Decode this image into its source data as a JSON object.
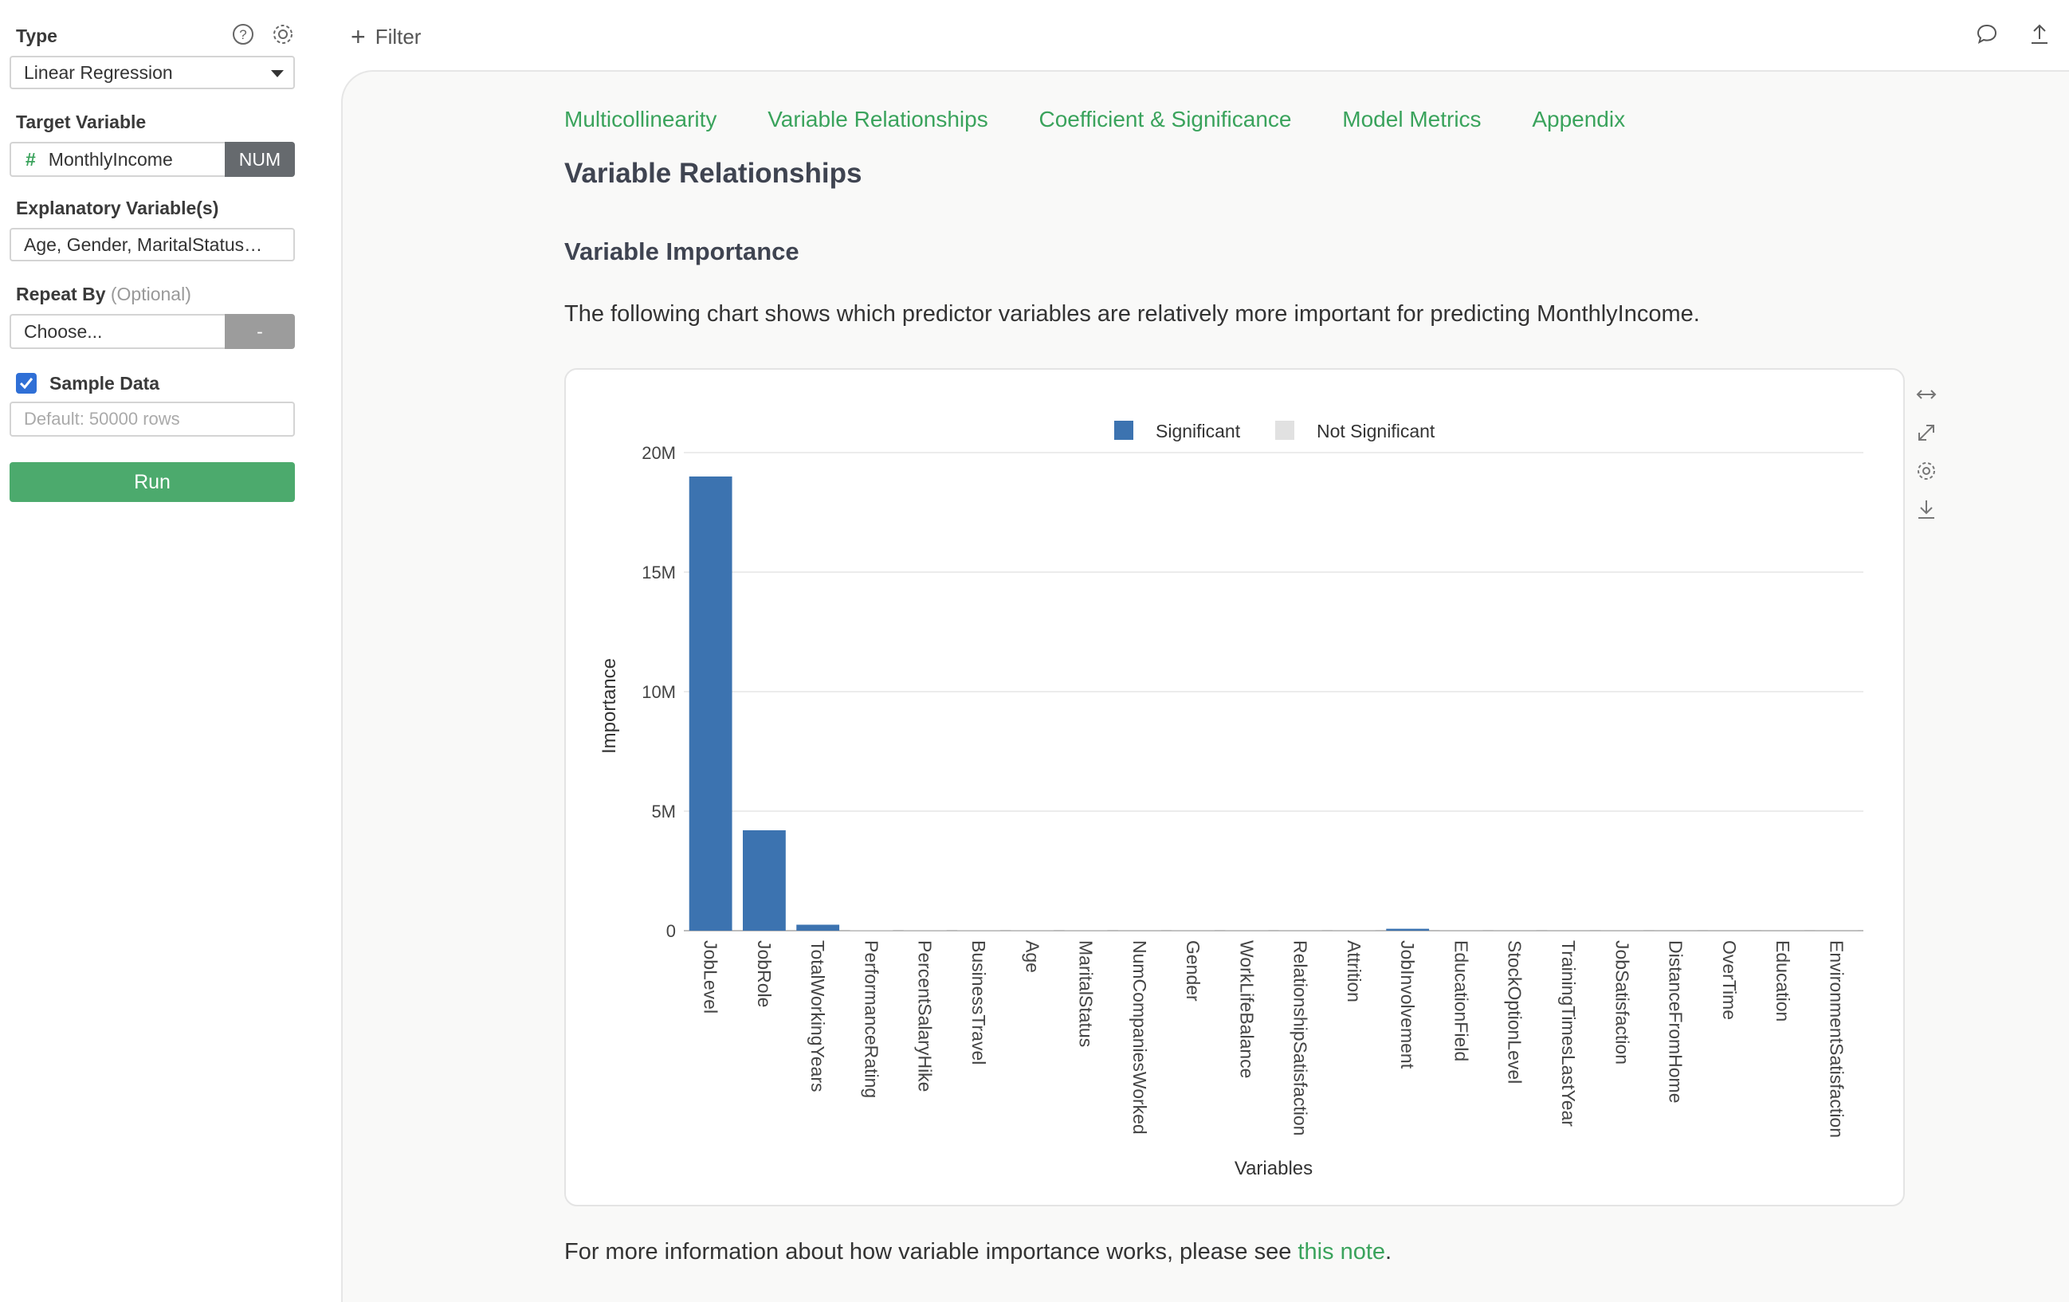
{
  "sidebar": {
    "type_label": "Type",
    "type_value": "Linear Regression",
    "target_label": "Target Variable",
    "target_hash": "#",
    "target_value": "MonthlyIncome",
    "target_badge": "NUM",
    "explanatory_label": "Explanatory Variable(s)",
    "explanatory_value": "Age, Gender, MaritalStatus…",
    "repeat_label": "Repeat By",
    "repeat_optional": "(Optional)",
    "repeat_value": "Choose...",
    "repeat_button": "-",
    "sample_label": "Sample Data",
    "sample_checked": true,
    "rows_placeholder": "Default: 50000 rows",
    "run_label": "Run"
  },
  "topbar": {
    "filter_label": "Filter"
  },
  "tabs": [
    {
      "label": "Multicollinearity"
    },
    {
      "label": "Variable Relationships"
    },
    {
      "label": "Coefficient & Significance"
    },
    {
      "label": "Model Metrics"
    },
    {
      "label": "Appendix"
    }
  ],
  "main": {
    "title": "Variable Relationships",
    "subtitle": "Variable Importance",
    "description": "The following chart shows which predictor variables are relatively more important for predicting MonthlyIncome.",
    "footer_prefix": "For more information about how variable importance works, please see ",
    "footer_link": "this note",
    "footer_suffix": "."
  },
  "colors": {
    "accent": "#3aa35c",
    "significant": "#3c73b0",
    "not_significant": "#e1e1e1"
  },
  "chart_data": {
    "type": "bar",
    "xlabel": "Variables",
    "ylabel": "Importance",
    "ylim": [
      0,
      20000000
    ],
    "yticks": [
      {
        "value": 0,
        "label": "0"
      },
      {
        "value": 5000000,
        "label": "5M"
      },
      {
        "value": 10000000,
        "label": "10M"
      },
      {
        "value": 15000000,
        "label": "15M"
      },
      {
        "value": 20000000,
        "label": "20M"
      }
    ],
    "legend": [
      {
        "name": "Significant",
        "color": "#3c73b0"
      },
      {
        "name": "Not Significant",
        "color": "#e1e1e1"
      }
    ],
    "legend_position": "top-center",
    "grid": true,
    "categories": [
      "JobLevel",
      "JobRole",
      "TotalWorkingYears",
      "PerformanceRating",
      "PercentSalaryHike",
      "BusinessTravel",
      "Age",
      "MaritalStatus",
      "NumCompaniesWorked",
      "Gender",
      "WorkLifeBalance",
      "RelationshipSatisfaction",
      "Attrition",
      "JobInvolvement",
      "EducationField",
      "StockOptionLevel",
      "TrainingTimesLastYear",
      "JobSatisfaction",
      "DistanceFromHome",
      "OverTime",
      "Education",
      "EnvironmentSatisfaction"
    ],
    "values": [
      19000000,
      4200000,
      250000,
      20000,
      15000,
      15000,
      12000,
      12000,
      10000,
      10000,
      10000,
      10000,
      8000,
      80000,
      8000,
      8000,
      8000,
      8000,
      6000,
      6000,
      6000,
      6000
    ],
    "significant": [
      true,
      true,
      true,
      false,
      false,
      false,
      false,
      false,
      false,
      false,
      false,
      false,
      false,
      true,
      false,
      false,
      false,
      false,
      false,
      false,
      false,
      false
    ]
  }
}
